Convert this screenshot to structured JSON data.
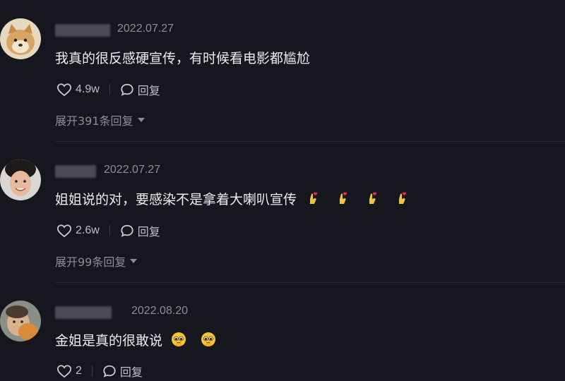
{
  "comments": [
    {
      "date": "2022.07.27",
      "text": "我真的很反感硬宣传，有时候看电影都尴尬",
      "likes": "4.9w",
      "reply_label": "回复",
      "expand_label": "展开391条回复"
    },
    {
      "date": "2022.07.27",
      "text": "姐姐说的对，要感染不是拿着大喇叭宣传",
      "likes": "2.6w",
      "reply_label": "回复",
      "expand_label": "展开99条回复"
    },
    {
      "date": "2022.08.20",
      "text": "金姐是真的很敢说",
      "likes": "2",
      "reply_label": "回复"
    }
  ],
  "colors": {
    "background": "#16161e",
    "text": "#ececf0",
    "secondary": "#8d8d95"
  }
}
